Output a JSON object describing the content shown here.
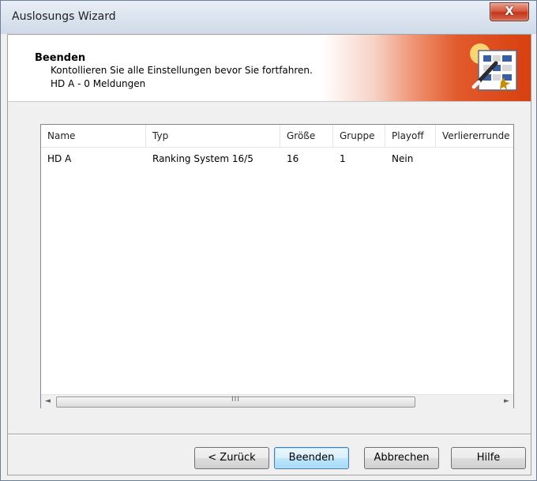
{
  "window": {
    "title": "Auslosungs Wizard",
    "close_glyph": "X"
  },
  "header": {
    "title": "Beenden",
    "subtitle": "Kontollieren Sie alle Einstellungen bevor Sie fortfahren.",
    "info": "HD A - 0 Meldungen",
    "icon": "wizard-icon"
  },
  "list": {
    "columns": [
      "Name",
      "Typ",
      "Größe",
      "Gruppe",
      "Playoff",
      "Verliererrunde"
    ],
    "rows": [
      [
        "HD A",
        "Ranking System 16/5",
        "16",
        "1",
        "Nein",
        ""
      ]
    ],
    "scrollbar": {
      "left_arrow": "◄",
      "right_arrow": "►",
      "grip": "III"
    }
  },
  "buttons": {
    "back": "< Zurück",
    "finish": "Beenden",
    "cancel": "Abbrechen",
    "help": "Hilfe"
  },
  "colors": {
    "accent": "#d8400f",
    "default_button": "#3c7fb1"
  }
}
